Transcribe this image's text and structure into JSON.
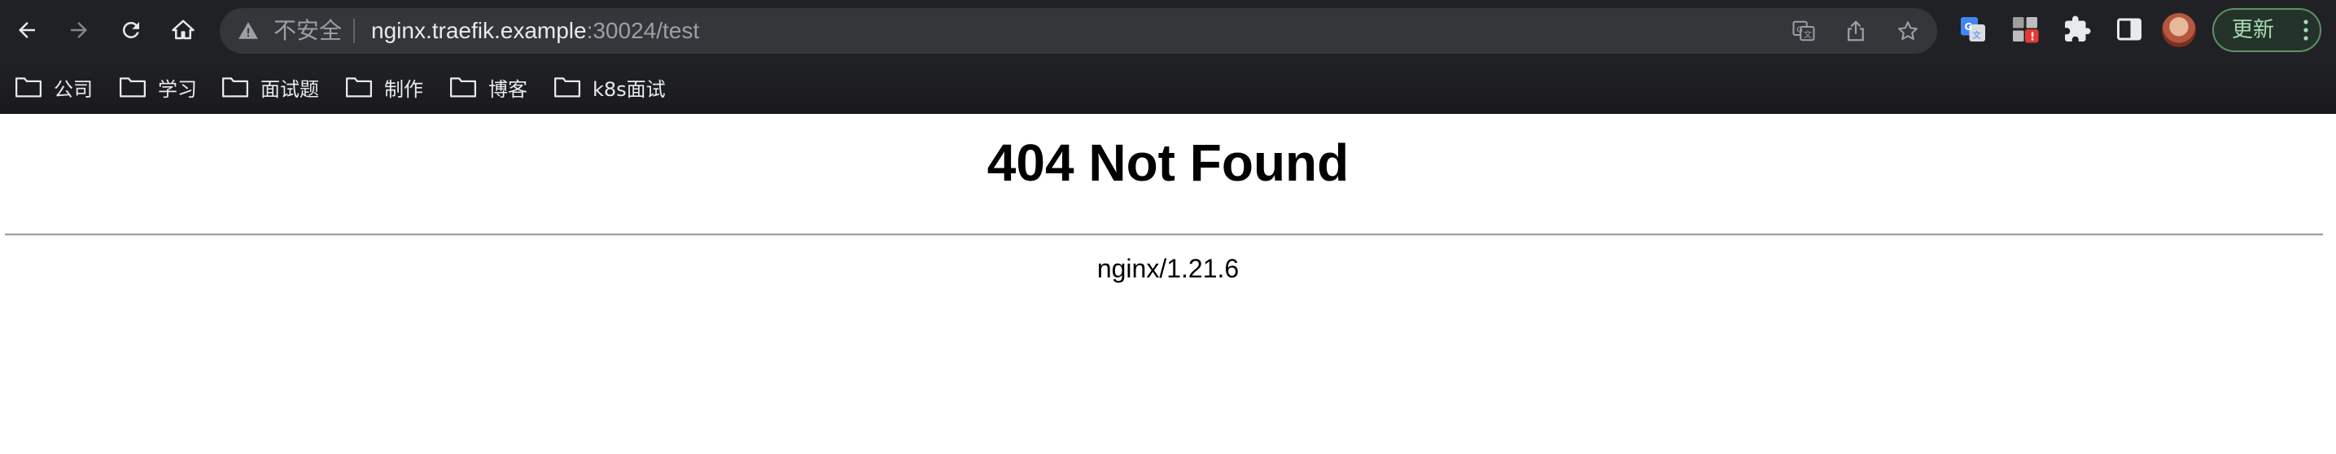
{
  "browser": {
    "nav": {
      "back_icon": "arrow-left-icon",
      "forward_icon": "arrow-right-icon",
      "reload_icon": "reload-icon",
      "home_icon": "home-icon"
    },
    "omnibox": {
      "security_label": "不安全",
      "url_host": "nginx.traefik.example",
      "url_rest": ":30024/test",
      "icons": [
        "translate-icon",
        "share-icon",
        "star-icon"
      ]
    },
    "extensions": [
      "google-translate-icon",
      "extension-alert-icon",
      "puzzle-icon",
      "side-panel-icon"
    ],
    "extension_badge": "!",
    "update_button_label": "更新",
    "bookmarks": [
      {
        "label": "公司"
      },
      {
        "label": "学习"
      },
      {
        "label": "面试题"
      },
      {
        "label": "制作"
      },
      {
        "label": "博客"
      },
      {
        "label": "k8s面试"
      }
    ]
  },
  "page": {
    "heading": "404 Not Found",
    "server": "nginx/1.21.6"
  },
  "colors": {
    "chrome_bg": "#202124",
    "omnibox_bg": "#35363a",
    "update_green": "#a8dab5"
  }
}
